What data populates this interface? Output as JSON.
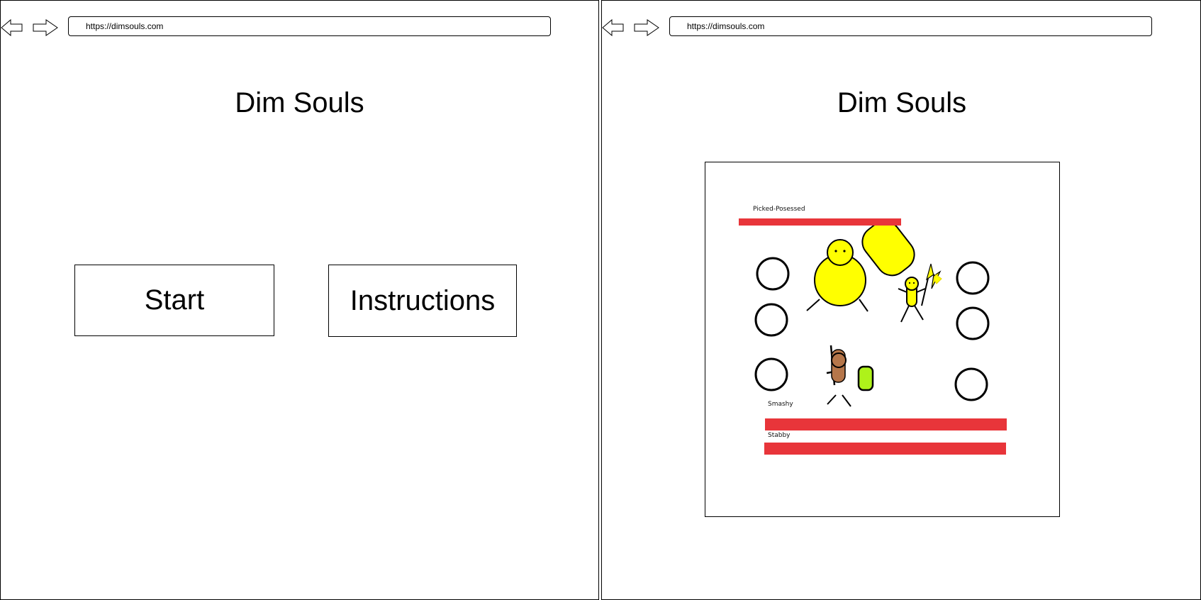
{
  "browser": {
    "url": "https://dimsouls.com"
  },
  "start_screen": {
    "title": "Dim Souls",
    "start_label": "Start",
    "instructions_label": "Instructions"
  },
  "game_screen": {
    "title": "Dim Souls",
    "enemy": {
      "name": "Picked-Posessed",
      "health_percent": 100,
      "bar_color": "#e8353a"
    },
    "players": [
      {
        "name": "Smashy",
        "health_percent": 100,
        "bar_color": "#e8353a"
      },
      {
        "name": "Stabby",
        "health_percent": 100,
        "bar_color": "#e8353a"
      }
    ]
  },
  "colors": {
    "character_yellow": "#ffff00",
    "shield_green": "#aef21a",
    "stabby_brown": "#b5764a",
    "health_red": "#e8353a"
  },
  "icons": {
    "back": "left-arrow-icon",
    "forward": "right-arrow-icon"
  }
}
